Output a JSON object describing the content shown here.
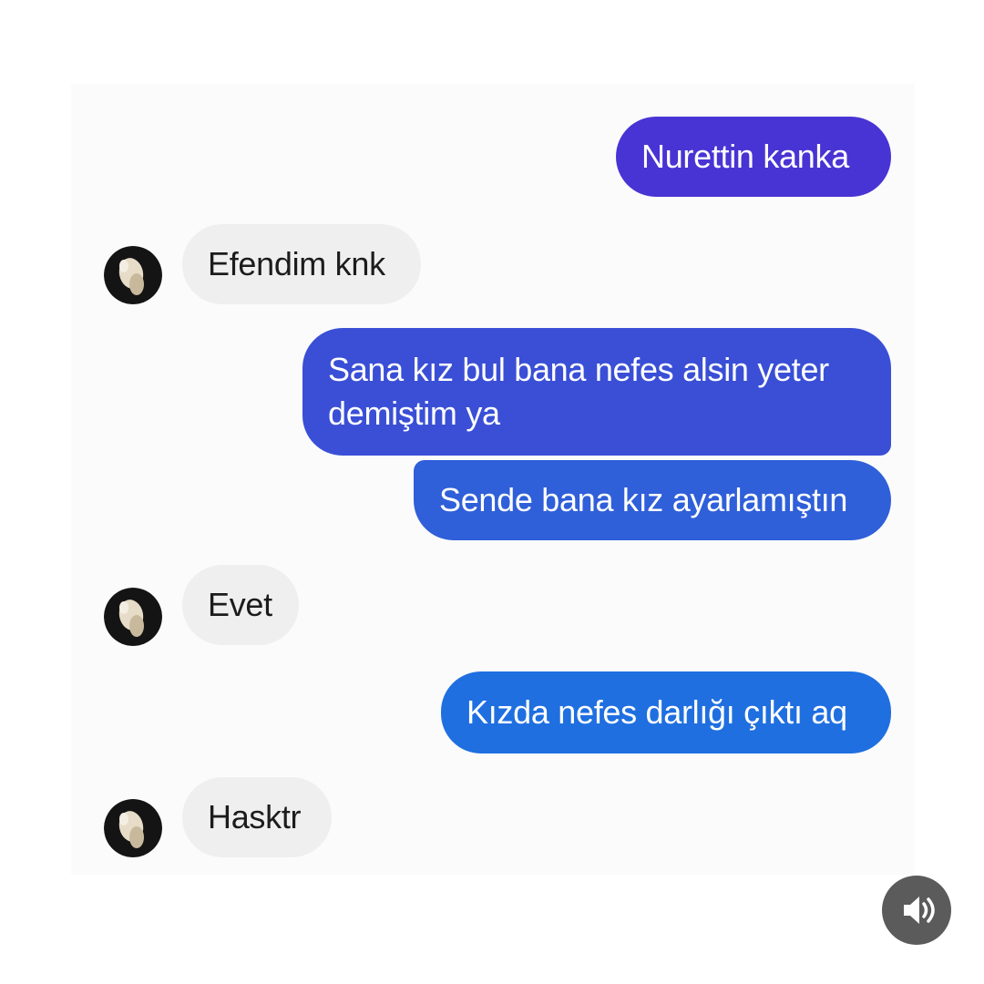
{
  "conversation": {
    "messages": [
      {
        "side": "sent",
        "text": "Nurettin kanka",
        "color": "#4834d4"
      },
      {
        "side": "received",
        "text": "Efendim knk"
      },
      {
        "side": "sent",
        "text": "Sana kız bul bana nefes alsin yeter",
        "text2": "demiştim ya",
        "color": "#3a4fd6"
      },
      {
        "side": "sent",
        "text": "Sende bana kız ayarlamıştın",
        "color": "#2f5fd9"
      },
      {
        "side": "received",
        "text": "Evet"
      },
      {
        "side": "sent",
        "text": "Kızda nefes darlığı çıktı aq",
        "color": "#1f6fe0"
      },
      {
        "side": "received",
        "text": "Hasktr"
      }
    ]
  },
  "colors": {
    "received_bubble": "#efefef",
    "sound_button": "#5b5b5b"
  },
  "icons": {
    "avatar": "profile-photo",
    "sound": "speaker-volume-icon"
  }
}
